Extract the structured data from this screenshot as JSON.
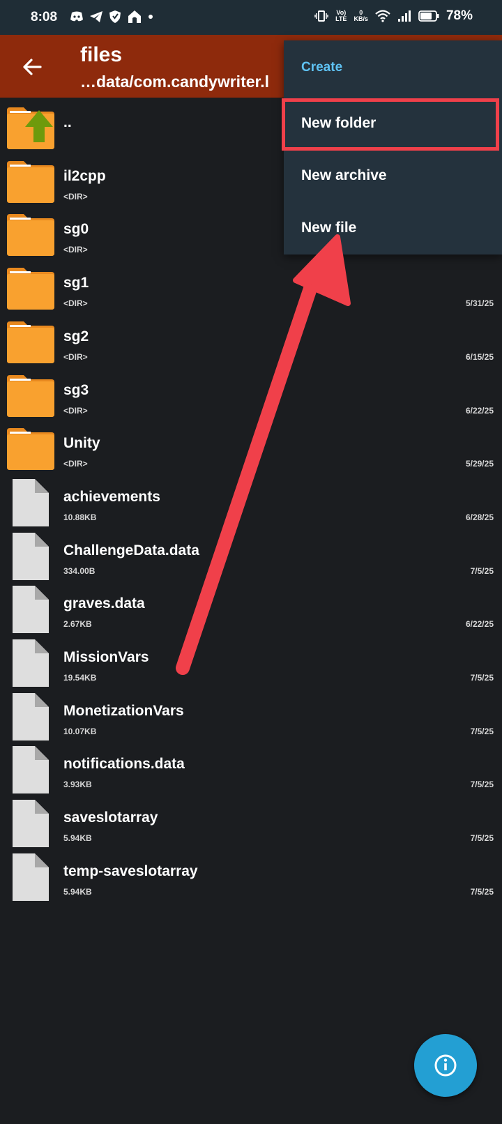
{
  "status_bar": {
    "time": "8:08",
    "network_label_top": "Vo)",
    "network_label_bottom": "LTE",
    "speed_value": "0",
    "speed_unit": "KB/s",
    "battery_percent": "78%"
  },
  "app_bar": {
    "title": "files",
    "path": "…data/com.candywriter.l"
  },
  "files": [
    {
      "name": "..",
      "meta": "",
      "date": "",
      "type": "parent"
    },
    {
      "name": "il2cpp",
      "meta": "<DIR>",
      "date": "",
      "type": "folder"
    },
    {
      "name": "sg0",
      "meta": "<DIR>",
      "date": "",
      "type": "folder"
    },
    {
      "name": "sg1",
      "meta": "<DIR>",
      "date": "5/31/25",
      "type": "folder"
    },
    {
      "name": "sg2",
      "meta": "<DIR>",
      "date": "6/15/25",
      "type": "folder"
    },
    {
      "name": "sg3",
      "meta": "<DIR>",
      "date": "6/22/25",
      "type": "folder"
    },
    {
      "name": "Unity",
      "meta": "<DIR>",
      "date": "5/29/25",
      "type": "folder"
    },
    {
      "name": "achievements",
      "meta": "10.88KB",
      "date": "6/28/25",
      "type": "file"
    },
    {
      "name": "ChallengeData.data",
      "meta": "334.00B",
      "date": "7/5/25",
      "type": "file"
    },
    {
      "name": "graves.data",
      "meta": "2.67KB",
      "date": "6/22/25",
      "type": "file"
    },
    {
      "name": "MissionVars",
      "meta": "19.54KB",
      "date": "7/5/25",
      "type": "file"
    },
    {
      "name": "MonetizationVars",
      "meta": "10.07KB",
      "date": "7/5/25",
      "type": "file"
    },
    {
      "name": "notifications.data",
      "meta": "3.93KB",
      "date": "7/5/25",
      "type": "file"
    },
    {
      "name": "saveslotarray",
      "meta": "5.94KB",
      "date": "7/5/25",
      "type": "file"
    },
    {
      "name": "temp-saveslotarray",
      "meta": "5.94KB",
      "date": "7/5/25",
      "type": "file"
    }
  ],
  "menu": {
    "header": "Create",
    "items": [
      "New folder",
      "New archive",
      "New file"
    ]
  },
  "colors": {
    "app_bar": "#8e2a0c",
    "folder": "#f9a12f",
    "menu_bg": "#24323d",
    "accent_text": "#5fc3f4",
    "annotation": "#f0404a",
    "fab": "#239fd3"
  },
  "icons": {
    "back": "arrow-left-icon",
    "fab": "info-icon"
  }
}
